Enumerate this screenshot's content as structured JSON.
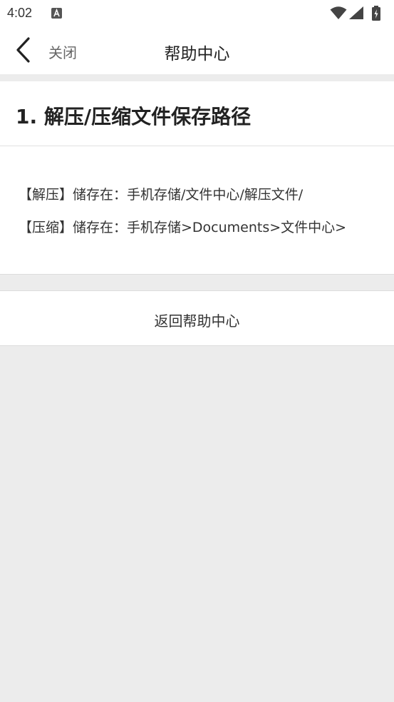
{
  "status_bar": {
    "time": "4:02",
    "notification_icon": "a-badge-icon",
    "icons": [
      "wifi-icon",
      "signal-icon",
      "battery-charging-icon"
    ]
  },
  "nav": {
    "back_icon": "chevron-left-icon",
    "close_label": "关闭",
    "title": "帮助中心"
  },
  "article": {
    "title": "1. 解压/压缩文件保存路径",
    "lines": [
      "【解压】储存在：手机存储/文件中心/解压文件/",
      "【压缩】储存在：手机存储>Documents>文件中心>"
    ]
  },
  "footer": {
    "return_label": "返回帮助中心"
  },
  "colors": {
    "background": "#ececec",
    "card": "#ffffff",
    "text": "#222222",
    "muted": "#666666"
  }
}
